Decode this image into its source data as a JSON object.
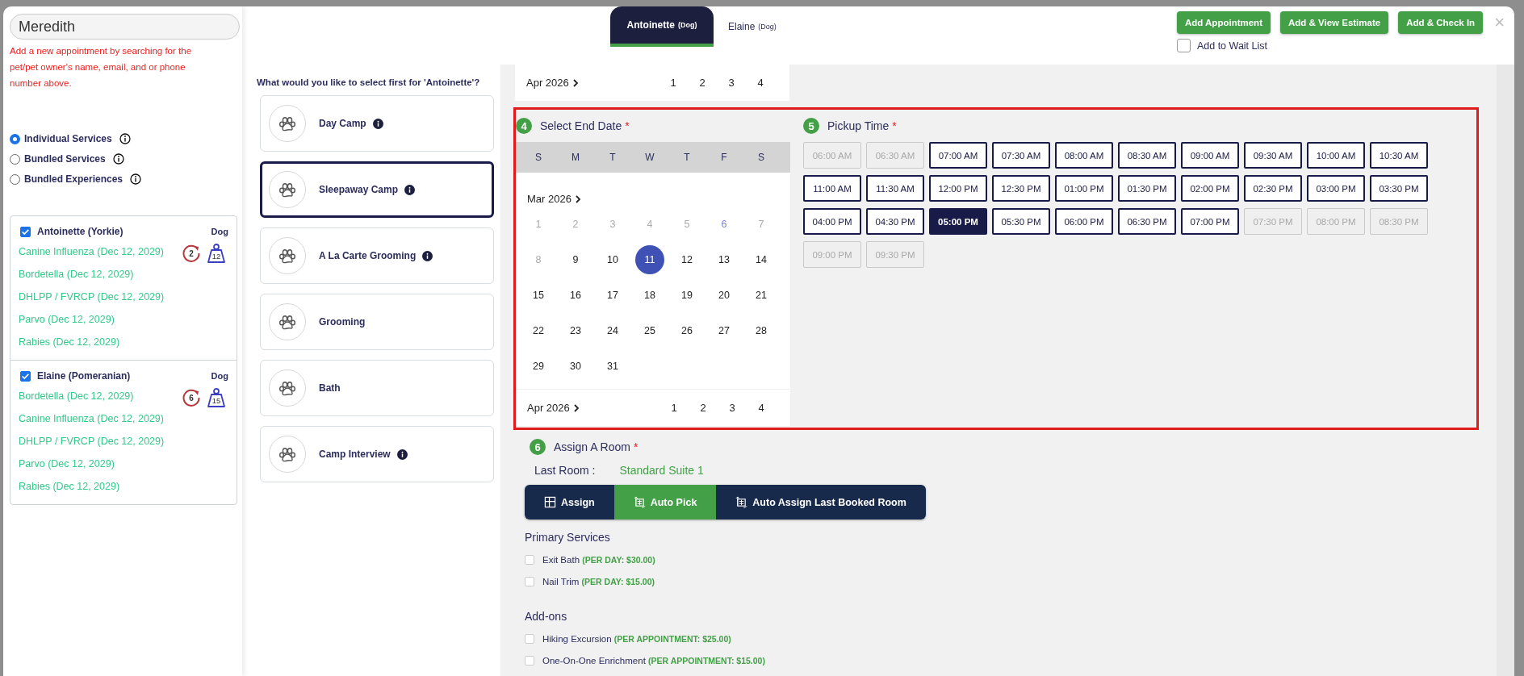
{
  "search": {
    "value": "Meredith"
  },
  "hint": "Add a new appointment by searching for the pet/pet owner's name, email, and or phone number above.",
  "service_types": [
    {
      "label": "Individual Services",
      "selected": true
    },
    {
      "label": "Bundled Services",
      "selected": false
    },
    {
      "label": "Bundled Experiences",
      "selected": false
    }
  ],
  "pets": [
    {
      "name": "Antoinette (Yorkie)",
      "checked": true,
      "species": "Dog",
      "visits": "2",
      "weight": "12",
      "vaccines": [
        "Canine Influenza (Dec 12, 2029)",
        "Bordetella (Dec 12, 2029)",
        "DHLPP / FVRCP (Dec 12, 2029)",
        "Parvo (Dec 12, 2029)",
        "Rabies (Dec 12, 2029)"
      ]
    },
    {
      "name": "Elaine (Pomeranian)",
      "checked": true,
      "species": "Dog",
      "visits": "6",
      "weight": "15",
      "vaccines": [
        "Bordetella (Dec 12, 2029)",
        "Canine Influenza (Dec 12, 2029)",
        "DHLPP / FVRCP (Dec 12, 2029)",
        "Parvo (Dec 12, 2029)",
        "Rabies (Dec 12, 2029)"
      ]
    }
  ],
  "pet_tabs": [
    {
      "name": "Antoinette",
      "species": "(Dog)",
      "selected": true
    },
    {
      "name": "Elaine",
      "species": "(Dog)",
      "selected": false
    }
  ],
  "actions": [
    "Add Appointment",
    "Add & View Estimate",
    "Add & Check In"
  ],
  "close": "×",
  "wait_list": {
    "label": "Add to Wait List",
    "checked": false
  },
  "prompt": "What would you like to select first for 'Antoinette'?",
  "services": [
    {
      "label": "Day Camp",
      "info": true,
      "selected": false
    },
    {
      "label": "Sleepaway Camp",
      "info": true,
      "selected": true
    },
    {
      "label": "A La Carte Grooming",
      "info": true,
      "selected": false
    },
    {
      "label": "Grooming",
      "info": false,
      "selected": false
    },
    {
      "label": "Bath",
      "info": false,
      "selected": false
    },
    {
      "label": "Camp Interview",
      "info": true,
      "selected": false
    }
  ],
  "start_calendar_tail": {
    "month": "Apr 2026",
    "days": [
      "1",
      "2",
      "3",
      "4"
    ]
  },
  "end_date": {
    "step": "4",
    "title": "Select End Date",
    "mark": "*",
    "weekdays": [
      "S",
      "M",
      "T",
      "W",
      "T",
      "F",
      "S"
    ],
    "month": "Mar 2026",
    "days": [
      {
        "label": "1",
        "disabled": true,
        "today": false,
        "selected": false
      },
      {
        "label": "2",
        "disabled": true,
        "today": false,
        "selected": false
      },
      {
        "label": "3",
        "disabled": true,
        "today": false,
        "selected": false
      },
      {
        "label": "4",
        "disabled": true,
        "today": false,
        "selected": false
      },
      {
        "label": "5",
        "disabled": true,
        "today": false,
        "selected": false
      },
      {
        "label": "6",
        "disabled": true,
        "today": true,
        "selected": false
      },
      {
        "label": "7",
        "disabled": true,
        "today": false,
        "selected": false
      },
      {
        "label": "8",
        "disabled": true,
        "today": false,
        "selected": false
      },
      {
        "label": "9",
        "disabled": false,
        "today": false,
        "selected": false
      },
      {
        "label": "10",
        "disabled": false,
        "today": false,
        "selected": false
      },
      {
        "label": "11",
        "disabled": false,
        "today": false,
        "selected": true
      },
      {
        "label": "12",
        "disabled": false,
        "today": false,
        "selected": false
      },
      {
        "label": "13",
        "disabled": false,
        "today": false,
        "selected": false
      },
      {
        "label": "14",
        "disabled": false,
        "today": false,
        "selected": false
      },
      {
        "label": "15",
        "disabled": false,
        "today": false,
        "selected": false
      },
      {
        "label": "16",
        "disabled": false,
        "today": false,
        "selected": false
      },
      {
        "label": "17",
        "disabled": false,
        "today": false,
        "selected": false
      },
      {
        "label": "18",
        "disabled": false,
        "today": false,
        "selected": false
      },
      {
        "label": "19",
        "disabled": false,
        "today": false,
        "selected": false
      },
      {
        "label": "20",
        "disabled": false,
        "today": false,
        "selected": false
      },
      {
        "label": "21",
        "disabled": false,
        "today": false,
        "selected": false
      },
      {
        "label": "22",
        "disabled": false,
        "today": false,
        "selected": false
      },
      {
        "label": "23",
        "disabled": false,
        "today": false,
        "selected": false
      },
      {
        "label": "24",
        "disabled": false,
        "today": false,
        "selected": false
      },
      {
        "label": "25",
        "disabled": false,
        "today": false,
        "selected": false
      },
      {
        "label": "26",
        "disabled": false,
        "today": false,
        "selected": false
      },
      {
        "label": "27",
        "disabled": false,
        "today": false,
        "selected": false
      },
      {
        "label": "28",
        "disabled": false,
        "today": false,
        "selected": false
      },
      {
        "label": "29",
        "disabled": false,
        "today": false,
        "selected": false
      },
      {
        "label": "30",
        "disabled": false,
        "today": false,
        "selected": false
      },
      {
        "label": "31",
        "disabled": false,
        "today": false,
        "selected": false
      }
    ],
    "next_month": "Apr 2026",
    "next_days": [
      "1",
      "2",
      "3",
      "4"
    ]
  },
  "pickup": {
    "step": "5",
    "title": "Pickup Time",
    "mark": "*",
    "slots": [
      {
        "label": "06:00 AM",
        "disabled": true,
        "selected": false
      },
      {
        "label": "06:30 AM",
        "disabled": true,
        "selected": false
      },
      {
        "label": "07:00 AM",
        "disabled": false,
        "selected": false
      },
      {
        "label": "07:30 AM",
        "disabled": false,
        "selected": false
      },
      {
        "label": "08:00 AM",
        "disabled": false,
        "selected": false
      },
      {
        "label": "08:30 AM",
        "disabled": false,
        "selected": false
      },
      {
        "label": "09:00 AM",
        "disabled": false,
        "selected": false
      },
      {
        "label": "09:30 AM",
        "disabled": false,
        "selected": false
      },
      {
        "label": "10:00 AM",
        "disabled": false,
        "selected": false
      },
      {
        "label": "10:30 AM",
        "disabled": false,
        "selected": false
      },
      {
        "label": "11:00 AM",
        "disabled": false,
        "selected": false
      },
      {
        "label": "11:30 AM",
        "disabled": false,
        "selected": false
      },
      {
        "label": "12:00 PM",
        "disabled": false,
        "selected": false
      },
      {
        "label": "12:30 PM",
        "disabled": false,
        "selected": false
      },
      {
        "label": "01:00 PM",
        "disabled": false,
        "selected": false
      },
      {
        "label": "01:30 PM",
        "disabled": false,
        "selected": false
      },
      {
        "label": "02:00 PM",
        "disabled": false,
        "selected": false
      },
      {
        "label": "02:30 PM",
        "disabled": false,
        "selected": false
      },
      {
        "label": "03:00 PM",
        "disabled": false,
        "selected": false
      },
      {
        "label": "03:30 PM",
        "disabled": false,
        "selected": false
      },
      {
        "label": "04:00 PM",
        "disabled": false,
        "selected": false
      },
      {
        "label": "04:30 PM",
        "disabled": false,
        "selected": false
      },
      {
        "label": "05:00 PM",
        "disabled": false,
        "selected": true
      },
      {
        "label": "05:30 PM",
        "disabled": false,
        "selected": false
      },
      {
        "label": "06:00 PM",
        "disabled": false,
        "selected": false
      },
      {
        "label": "06:30 PM",
        "disabled": false,
        "selected": false
      },
      {
        "label": "07:00 PM",
        "disabled": false,
        "selected": false
      },
      {
        "label": "07:30 PM",
        "disabled": true,
        "selected": false
      },
      {
        "label": "08:00 PM",
        "disabled": true,
        "selected": false
      },
      {
        "label": "08:30 PM",
        "disabled": true,
        "selected": false
      },
      {
        "label": "09:00 PM",
        "disabled": true,
        "selected": false
      },
      {
        "label": "09:30 PM",
        "disabled": true,
        "selected": false
      }
    ]
  },
  "room": {
    "step": "6",
    "title": "Assign A Room",
    "mark": "*",
    "last_label": "Last Room :",
    "last_value": "Standard Suite 1",
    "modes": [
      {
        "label": "Assign",
        "kind": "grid",
        "selected": false
      },
      {
        "label": "Auto Pick",
        "kind": "auto",
        "selected": true
      },
      {
        "label": "Auto Assign Last Booked Room",
        "kind": "auto",
        "selected": false
      }
    ]
  },
  "option_groups": [
    {
      "title": "Primary Services",
      "items": [
        {
          "name": "Exit Bath",
          "price": "(PER DAY: $30.00)",
          "checked": false
        },
        {
          "name": "Nail Trim",
          "price": "(PER DAY: $15.00)",
          "checked": false
        }
      ]
    },
    {
      "title": "Add-ons",
      "items": [
        {
          "name": "Hiking Excursion",
          "price": "(PER APPOINTMENT: $25.00)",
          "checked": false
        },
        {
          "name": "One-On-One Enrichment",
          "price": "(PER APPOINTMENT: $15.00)",
          "checked": false
        }
      ]
    }
  ]
}
